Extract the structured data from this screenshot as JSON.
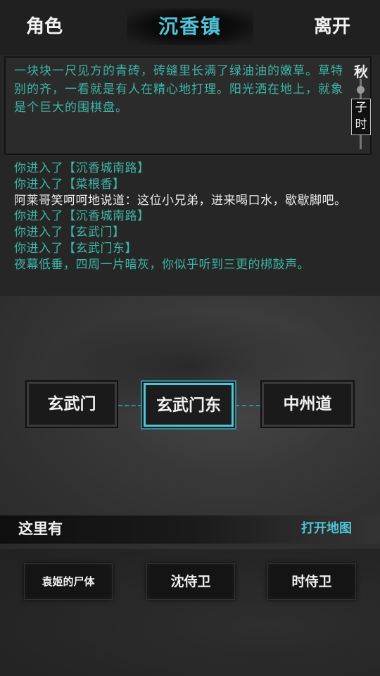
{
  "header": {
    "left_button": "角色",
    "title": "沉香镇",
    "right_button": "离开"
  },
  "description": {
    "text": "一块块一尺见方的青砖，砖缝里长满了绿油油的嫩草。草特别的齐，一看就是有人在精心地打理。阳光洒在地上，就象是个巨大的围棋盘。"
  },
  "time": {
    "season": "秋",
    "hour": "子时"
  },
  "log": [
    {
      "text": "你进入了【沉香城南路】",
      "color": "teal"
    },
    {
      "text": "你进入了【菜根香】",
      "color": "teal"
    },
    {
      "text": "阿莱哥笑呵呵地说道：这位小兄弟，进来喝口水，歇歇脚吧。",
      "color": "white"
    },
    {
      "text": "你进入了【沉香城南路】",
      "color": "teal"
    },
    {
      "text": "你进入了【玄武门】",
      "color": "teal"
    },
    {
      "text": "你进入了【玄武门东】",
      "color": "teal"
    },
    {
      "text": "夜幕低垂，四周一片暗灰，你似乎听到三更的梆鼓声。",
      "color": "teal"
    }
  ],
  "map": {
    "west": "玄武门",
    "current": "玄武门东",
    "east": "中州道"
  },
  "here": {
    "label": "这里有",
    "open_map": "打开地图"
  },
  "npcs": [
    "袁姬的尸体",
    "沈侍卫",
    "时侍卫"
  ],
  "colors": {
    "accent": "#4fc4d6",
    "log_teal": "#3db6a5",
    "background": "#262626"
  }
}
